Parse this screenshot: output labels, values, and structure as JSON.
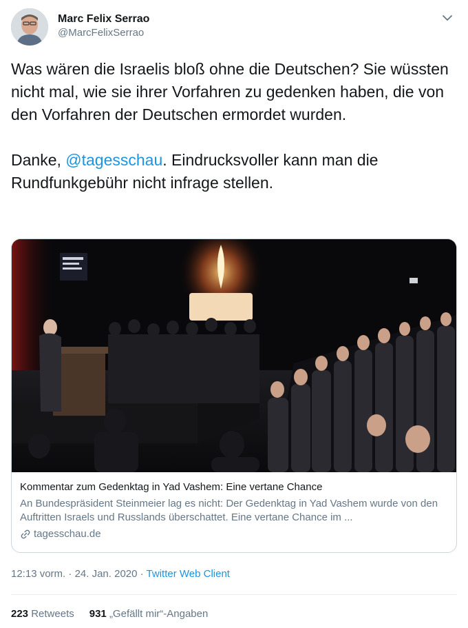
{
  "author": {
    "display_name": "Marc Felix Serrao",
    "handle": "@MarcFelixSerrao"
  },
  "icons": {
    "menu": "chevron-down-icon",
    "link": "link-icon"
  },
  "tweet": {
    "paragraph1": "Was wären die Israelis bloß ohne die Deutschen? Sie wüssten nicht mal, wie sie ihrer Vorfahren zu gedenken haben, die von den Vorfahren der Deutschen ermordet wurden.",
    "p2_prefix": "Danke, ",
    "p2_mention": "@tagesschau",
    "p2_suffix": ". Eindrucksvoller kann man die Rundfunkgebühr nicht infrage stellen."
  },
  "card": {
    "title": "Kommentar zum Gedenktag in Yad Vashem: Eine vertane Chance",
    "description": "An Bundespräsident Steinmeier lag es nicht: Der Gedenktag in Yad Vashem wurde von den Auftritten Israels und Russlands überschattet. Eine vertane Chance im ...",
    "domain": "tagesschau.de"
  },
  "meta": {
    "time": "12:13 vorm.",
    "separator": " · ",
    "date": "24. Jan. 2020",
    "client": "Twitter Web Client"
  },
  "stats": {
    "retweets_count": "223",
    "retweets_label": "Retweets",
    "likes_count": "931",
    "likes_label": "„Gefällt mir“-Angaben"
  },
  "colors": {
    "link": "#1b95e0",
    "secondary_text": "#657786",
    "primary_text": "#14171a",
    "border": "#ccd6dd"
  }
}
